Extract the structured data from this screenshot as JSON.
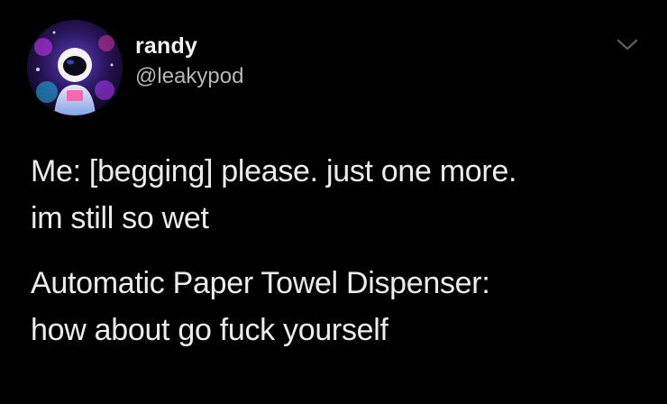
{
  "tweet": {
    "display_name": "randy",
    "handle": "@leakypod",
    "paragraphs": [
      [
        "Me: [begging] please. just one more.",
        "im still so wet"
      ],
      [
        "Automatic Paper Towel Dispenser:",
        "how about go fuck yourself"
      ]
    ]
  },
  "icons": {
    "avatar": "astronaut-avatar",
    "menu": "chevron-down-icon"
  },
  "colors": {
    "background": "#000000",
    "text": "#ececec",
    "handle": "#b7b7b7",
    "chevron": "#5a5a5a"
  }
}
